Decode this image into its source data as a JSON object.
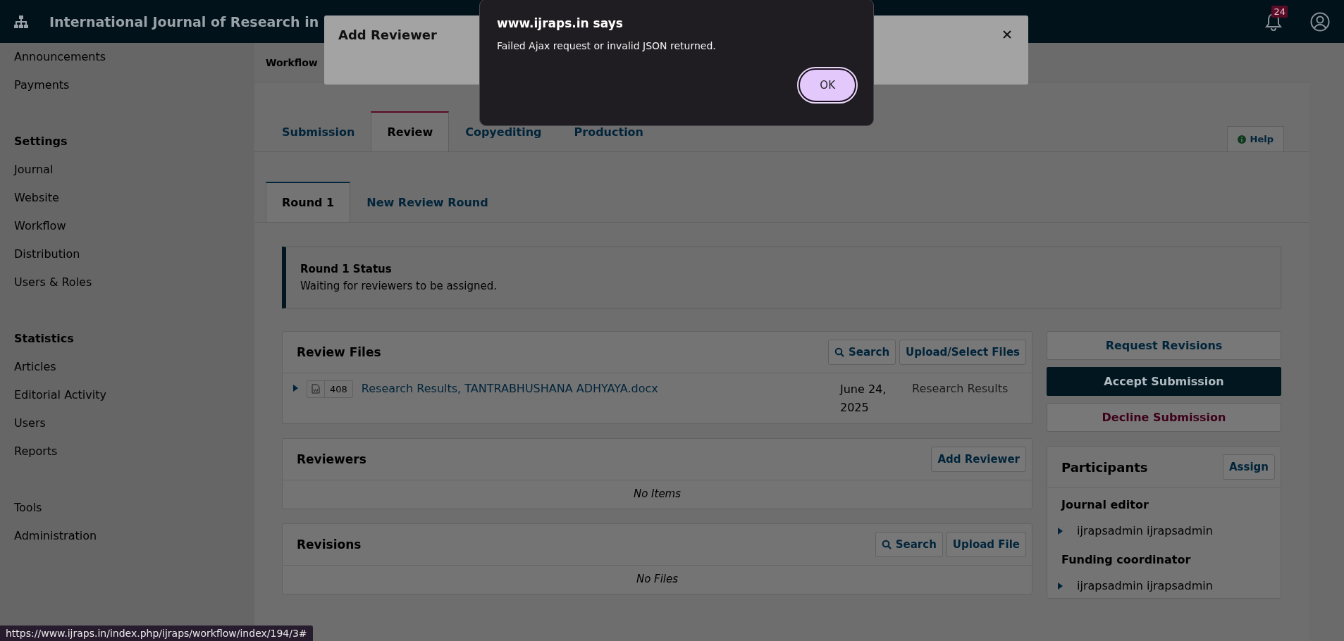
{
  "header": {
    "title": "International Journal of Research in",
    "notification_count": "24"
  },
  "sidebar": {
    "sections": [
      {
        "items": [
          "Announcements",
          "Payments"
        ]
      },
      {
        "heading": "Settings",
        "items": [
          "Journal",
          "Website",
          "Workflow",
          "Distribution",
          "Users & Roles"
        ]
      },
      {
        "heading": "Statistics",
        "items": [
          "Articles",
          "Editorial Activity",
          "Users",
          "Reports"
        ]
      },
      {
        "items": [
          "Tools",
          "Administration"
        ]
      }
    ]
  },
  "breadcrumb": "Workflow",
  "stage_tabs": [
    {
      "label": "Submission",
      "selected": false
    },
    {
      "label": "Review",
      "selected": true
    },
    {
      "label": "Copyediting",
      "selected": false
    },
    {
      "label": "Production",
      "selected": false
    }
  ],
  "help_button": "Help",
  "round_tabs": [
    {
      "label": "Round 1",
      "selected": true
    },
    {
      "label": "New Review Round",
      "selected": false
    }
  ],
  "round_status": {
    "title": "Round 1 Status",
    "message": "Waiting for reviewers to be assigned."
  },
  "panels": [
    {
      "title": "Review Files",
      "actions": [
        {
          "label": "Search",
          "kind": "search"
        },
        {
          "label": "Upload/Select Files",
          "kind": "upload"
        }
      ],
      "files": [
        {
          "id": "408",
          "name": "Research Results, TANTRABHUSHANA ADHYAYA.docx",
          "date": "June 24, 2025",
          "type": "Research Results"
        }
      ]
    },
    {
      "title": "Reviewers",
      "actions": [
        {
          "label": "Add Reviewer",
          "kind": "add"
        }
      ],
      "empty": "No Items"
    },
    {
      "title": "Revisions",
      "actions": [
        {
          "label": "Search",
          "kind": "search"
        },
        {
          "label": "Upload File",
          "kind": "upload"
        }
      ],
      "empty": "No Files"
    }
  ],
  "decisions": [
    {
      "label": "Request Revisions",
      "kind": "secondary"
    },
    {
      "label": "Accept Submission",
      "kind": "primary"
    },
    {
      "label": "Decline Submission",
      "kind": "danger"
    }
  ],
  "participants": {
    "title": "Participants",
    "assign": "Assign",
    "groups": [
      {
        "role": "Journal editor",
        "members": [
          "ijrapsadmin ijrapsadmin"
        ]
      },
      {
        "role": "Funding coordinator",
        "members": [
          "ijrapsadmin ijrapsadmin"
        ]
      }
    ]
  },
  "modal": {
    "title": "Add Reviewer"
  },
  "alert": {
    "origin": "www.ijraps.in says",
    "message": "Failed Ajax request or invalid JSON returned.",
    "button": "OK"
  },
  "status_url": "https://www.ijraps.in/index.php/ijraps/workflow/index/194/3#"
}
